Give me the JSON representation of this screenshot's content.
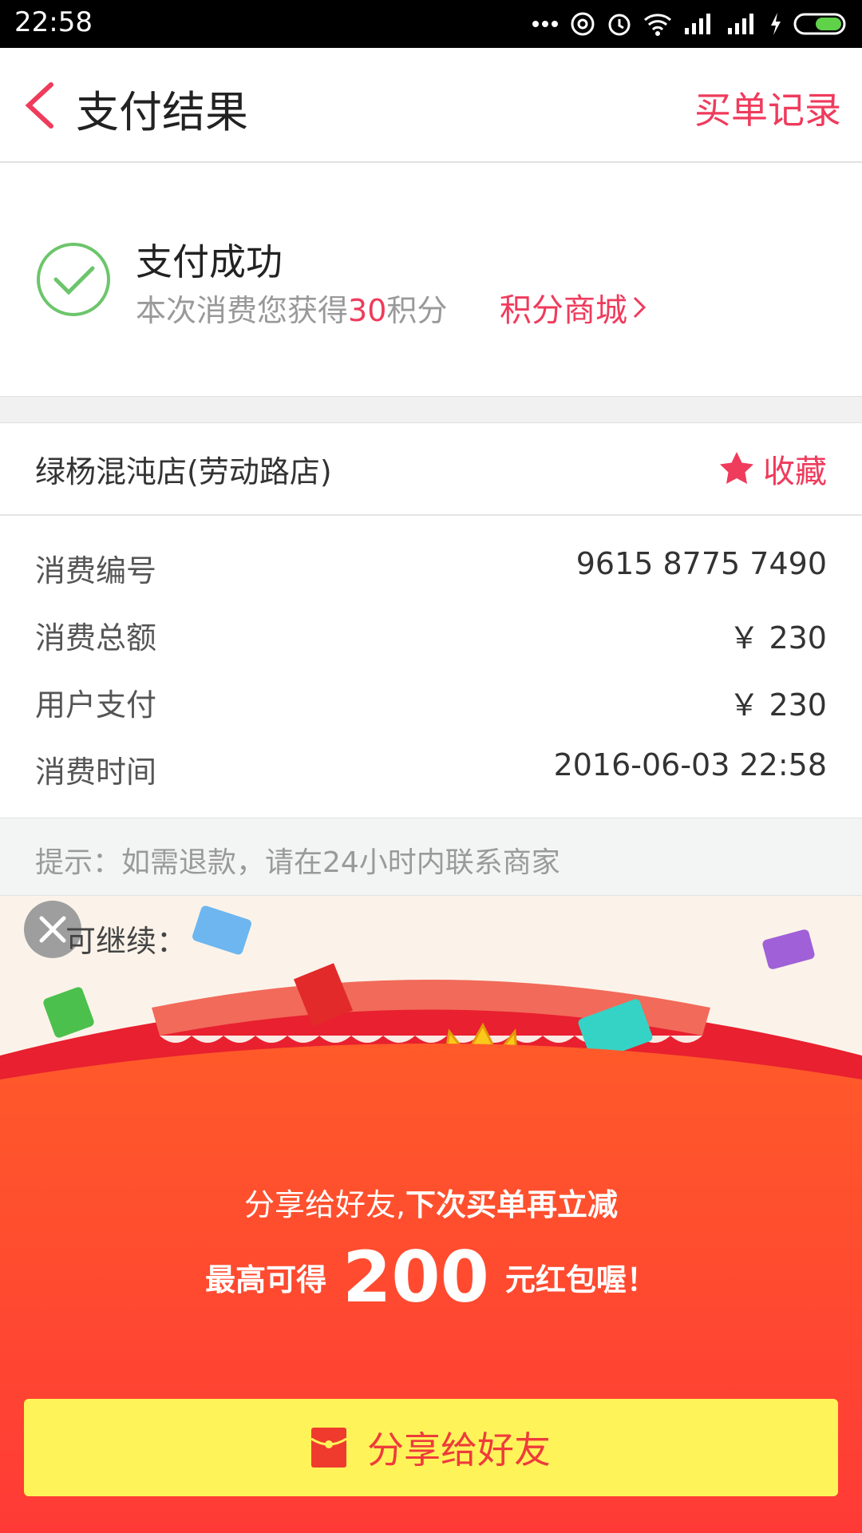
{
  "status_bar": {
    "time": "22:58"
  },
  "header": {
    "title": "支付结果",
    "records_link": "买单记录"
  },
  "success": {
    "title": "支付成功",
    "points_prefix": "本次消费您获得",
    "points_value": "30",
    "points_suffix": "积分",
    "mall_link": "积分商城"
  },
  "store": {
    "name": "绿杨混沌店(劳动路店)",
    "favorite_label": "收藏"
  },
  "details": [
    {
      "label": "消费编号",
      "value": "9615 8775 7490"
    },
    {
      "label": "消费总额",
      "value": "￥ 230"
    },
    {
      "label": "用户支付",
      "value": "￥ 230"
    },
    {
      "label": "消费时间",
      "value": "2016-06-03 22:58"
    }
  ],
  "tip": "提示：如需退款，请在24小时内联系商家",
  "promo": {
    "continue_label": "可继续：",
    "line1_normal": "分享给好友,",
    "line1_bold": "下次买单再立减",
    "line2_prefix": "最高可得",
    "line2_amount": "200",
    "line2_suffix": "元红包喔！",
    "share_button": "分享给好友"
  },
  "colors": {
    "accent": "#ef3b5c",
    "success_green": "#6cc56b",
    "promo_red": "#f9432e",
    "button_yellow": "#fef45a"
  }
}
